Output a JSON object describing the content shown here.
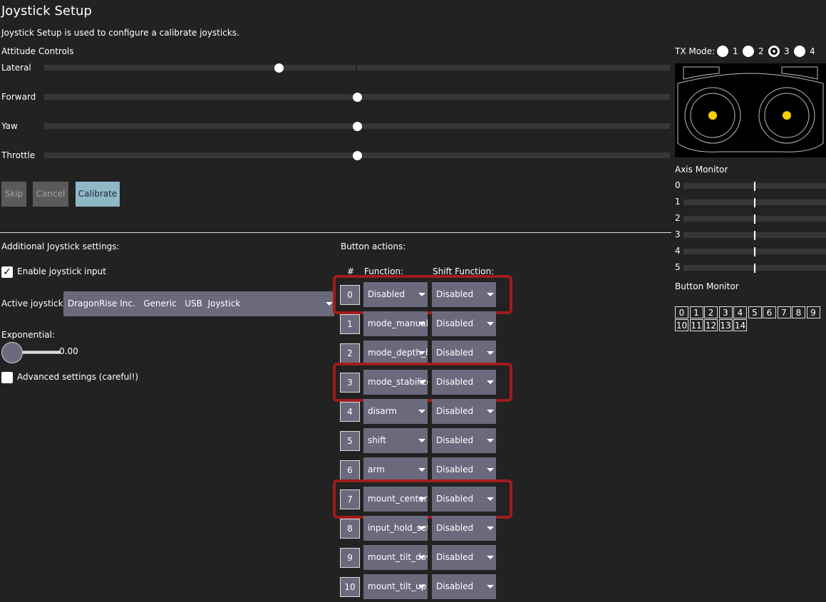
{
  "page": {
    "title": "Joystick Setup",
    "description": "Joystick Setup is used to configure a calibrate joysticks."
  },
  "attitude": {
    "heading": "Attitude Controls",
    "sliders": [
      {
        "label": "Lateral",
        "value": 0.75
      },
      {
        "label": "Forward",
        "value": 1.0
      },
      {
        "label": "Yaw",
        "value": 1.0
      },
      {
        "label": "Throttle",
        "value": 1.0
      }
    ]
  },
  "buttons": {
    "skip": "Skip",
    "cancel": "Cancel",
    "calibrate": "Calibrate"
  },
  "additional": {
    "heading": "Additional Joystick settings:",
    "enable_label": "Enable joystick input",
    "enable_checked": true,
    "active_label": "Active joystick:",
    "active_value": "DragonRise Inc.   Generic   USB  Joystick",
    "exponential_label": "Exponential:",
    "exponential_value": "0.00",
    "advanced_label": "Advanced settings (careful!)"
  },
  "actions": {
    "heading": "Button actions:",
    "col_num": "#",
    "col_function": "Function:",
    "col_shift": "Shift Function:",
    "rows": [
      {
        "num": "0",
        "function": "Disabled",
        "shift": "Disabled",
        "highlight": true
      },
      {
        "num": "1",
        "function": "mode_manual",
        "shift": "Disabled",
        "highlight": false
      },
      {
        "num": "2",
        "function": "mode_depth_hold",
        "shift": "Disabled",
        "highlight": false
      },
      {
        "num": "3",
        "function": "mode_stabilize",
        "shift": "Disabled",
        "highlight": true
      },
      {
        "num": "4",
        "function": "disarm",
        "shift": "Disabled",
        "highlight": false
      },
      {
        "num": "5",
        "function": "shift",
        "shift": "Disabled",
        "highlight": false
      },
      {
        "num": "6",
        "function": "arm",
        "shift": "Disabled",
        "highlight": false
      },
      {
        "num": "7",
        "function": "mount_center",
        "shift": "Disabled",
        "highlight": true
      },
      {
        "num": "8",
        "function": "input_hold_set",
        "shift": "Disabled",
        "highlight": false
      },
      {
        "num": "9",
        "function": "mount_tilt_down",
        "shift": "Disabled",
        "highlight": false
      },
      {
        "num": "10",
        "function": "mount_tilt_up",
        "shift": "Disabled",
        "highlight": false
      }
    ]
  },
  "tx_mode": {
    "label": "TX Mode:",
    "options": [
      "1",
      "2",
      "3",
      "4"
    ],
    "selected": "3"
  },
  "axis_monitor": {
    "heading": "Axis Monitor",
    "axes": [
      {
        "label": "0",
        "value": 0.5
      },
      {
        "label": "1",
        "value": 0.5
      },
      {
        "label": "2",
        "value": 0.5
      },
      {
        "label": "3",
        "value": 0.5
      },
      {
        "label": "4",
        "value": 0.5
      },
      {
        "label": "5",
        "value": 0.5
      }
    ]
  },
  "button_monitor": {
    "heading": "Button Monitor",
    "buttons": [
      "0",
      "1",
      "2",
      "3",
      "4",
      "5",
      "6",
      "7",
      "8",
      "9",
      "10",
      "11",
      "12",
      "13",
      "14"
    ]
  },
  "colors": {
    "background": "#222222",
    "track": "#373737",
    "select": "#6b6a7d",
    "highlight": "#a11c1c",
    "calibrate": "#8fb8c6",
    "stick_dot": "#f5d000"
  }
}
